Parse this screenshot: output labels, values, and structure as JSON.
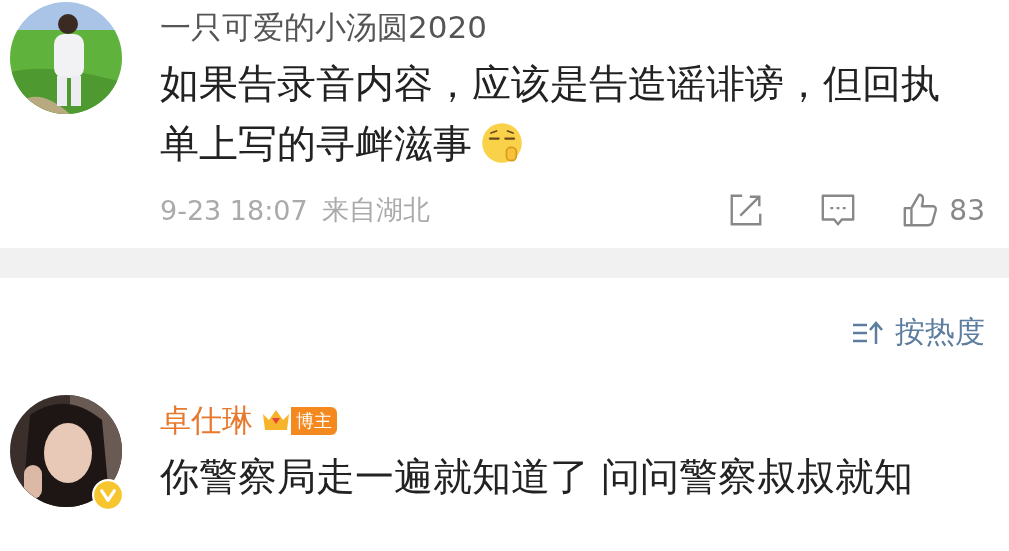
{
  "comments_top": [
    {
      "username": "一只可爱的小汤圆2020",
      "is_author": false,
      "avatar": {
        "kind": "picture",
        "verified": false
      },
      "text": "如果告录音内容，应该是告造谣诽谤，但回执单上写的寻衅滋事",
      "emoji": true,
      "time": "9-23 18:07",
      "location": "来自湖北",
      "likes": "83"
    }
  ],
  "sort": {
    "label": "按热度"
  },
  "comments_bottom": [
    {
      "username": "卓仕琳",
      "is_author": true,
      "badge": "博主",
      "avatar": {
        "kind": "picture",
        "verified": true
      },
      "text": "你警察局走一遍就知道了 问问警察叔叔就知"
    }
  ]
}
